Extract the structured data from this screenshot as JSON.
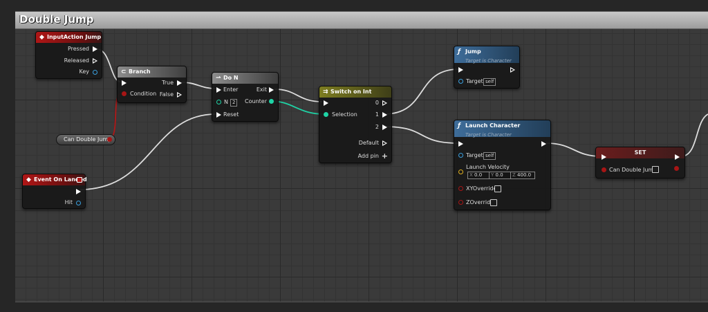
{
  "window": {
    "title": "Double Jump"
  },
  "colors": {
    "exec": "#ffffff",
    "bool": "#a71515",
    "int": "#1fd4a6",
    "object": "#3aa0e0",
    "vector": "#e0b020",
    "event_header": "#b01616",
    "function_header": "#3e6d9a"
  },
  "nodes": {
    "input_action": {
      "title": "InputAction Jump",
      "icon": "event-diamond-icon",
      "pins": {
        "pressed": "Pressed",
        "released": "Released",
        "key": "Key"
      }
    },
    "branch": {
      "title": "Branch",
      "icon": "branch-icon",
      "pins": {
        "condition": "Condition",
        "true": "True",
        "false": "False"
      }
    },
    "can_double_jump_getter": {
      "label": "Can Double Jump"
    },
    "event_landed": {
      "title": "Event On Landed",
      "icon": "event-diamond-icon",
      "pins": {
        "hit": "Hit"
      }
    },
    "do_n": {
      "title": "Do N",
      "icon": "arrow-icon",
      "pins": {
        "enter": "Enter",
        "n": "N",
        "n_value": "2",
        "reset": "Reset",
        "exit": "Exit",
        "counter": "Counter"
      }
    },
    "switch_int": {
      "title": "Switch on Int",
      "icon": "switch-icon",
      "pins": {
        "selection": "Selection",
        "out0": "0",
        "out1": "1",
        "out2": "2",
        "default": "Default",
        "add_pin": "Add pin"
      }
    },
    "jump": {
      "title": "Jump",
      "subtitle": "Target is Character",
      "icon": "function-icon",
      "pins": {
        "target": "Target",
        "target_value": "self"
      }
    },
    "launch_character": {
      "title": "Launch Character",
      "subtitle": "Target is Character",
      "icon": "function-icon",
      "pins": {
        "target": "Target",
        "target_value": "self",
        "launch_velocity": "Launch Velocity",
        "x_label": "X",
        "x": "0.0",
        "y_label": "Y",
        "y": "0.0",
        "z_label": "Z",
        "z": "400.0",
        "xy_override": "XYOverride",
        "z_override": "ZOverride"
      }
    },
    "set": {
      "title": "SET",
      "pins": {
        "can_double_jump": "Can Double Jump"
      }
    }
  }
}
